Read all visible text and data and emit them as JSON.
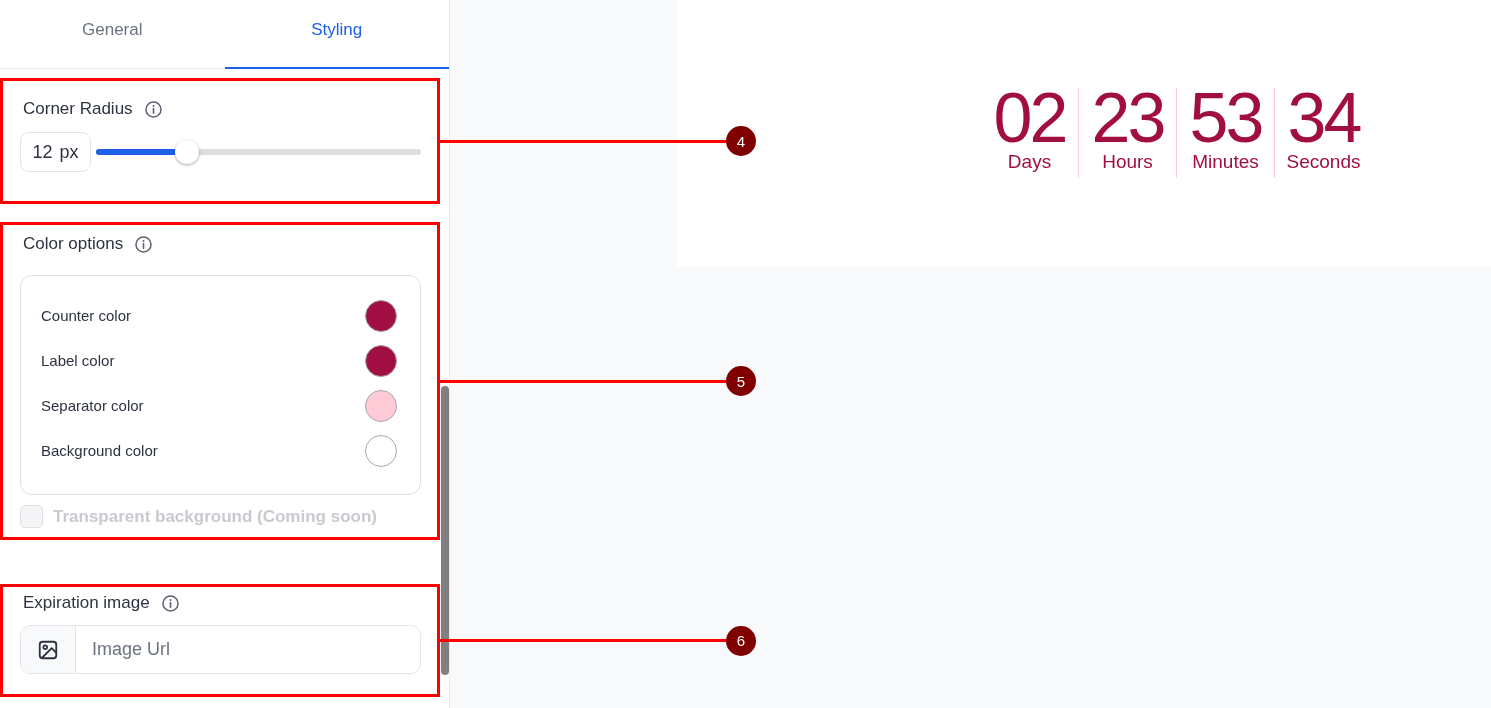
{
  "tabs": [
    {
      "label": "General",
      "selected": false
    },
    {
      "label": "Styling",
      "selected": true
    }
  ],
  "sections": [
    {
      "kind": "slider",
      "title": "Corner Radius",
      "value": "12",
      "unit": "px",
      "level": 0.28,
      "callout": "4"
    },
    {
      "kind": "colors",
      "title": "Color options",
      "options": [
        {
          "label": "Counter color",
          "color": "#a10f42"
        },
        {
          "label": "Label color",
          "color": "#a10f42"
        },
        {
          "label": "Separator color",
          "color": "#fdcad6"
        },
        {
          "label": "Background color",
          "color": "#ffffff"
        }
      ],
      "checkbox": {
        "label": "Transparent background (Coming soon)",
        "checked": false,
        "disabled": true
      },
      "callout": "5"
    },
    {
      "kind": "image",
      "title": "Expiration image",
      "placeholder": "Image Url",
      "callout": "6"
    }
  ],
  "preview": {
    "units": [
      {
        "value": "02",
        "label": "Days"
      },
      {
        "value": "23",
        "label": "Hours"
      },
      {
        "value": "53",
        "label": "Minutes"
      },
      {
        "value": "34",
        "label": "Seconds"
      }
    ]
  }
}
